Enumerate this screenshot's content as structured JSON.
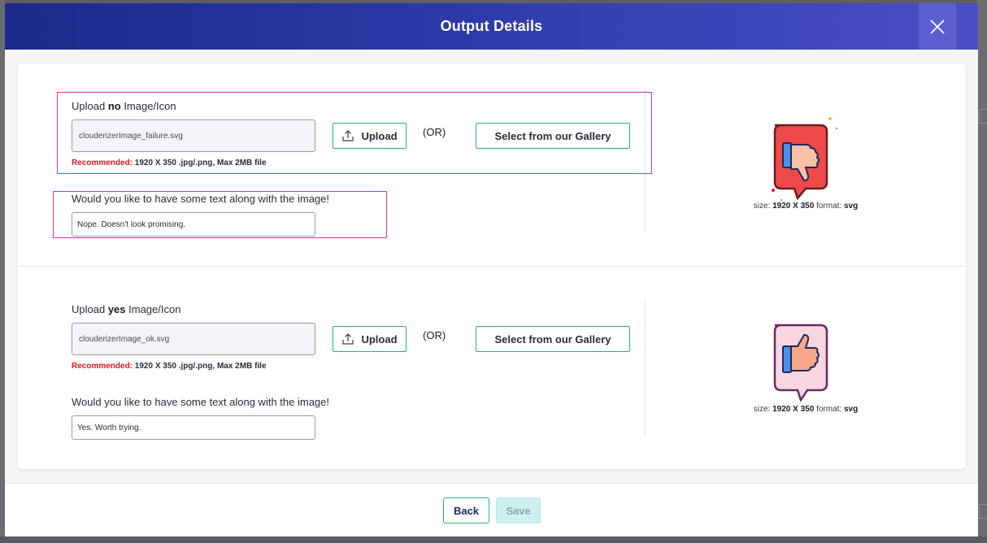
{
  "modal": {
    "title": "Output Details"
  },
  "no_section": {
    "label_prefix": "Upload ",
    "label_bold": "no",
    "label_suffix": " Image/Icon",
    "file_name": "clouderizerImage_failure.svg",
    "upload_label": "Upload",
    "or_label": "(OR)",
    "gallery_label": "Select from our Gallery",
    "recommended_label": "Recommended:",
    "recommended_text": " 1920 X 350 .jpg/.png, Max 2MB file",
    "text_question": "Would you like to have some text along with the image!",
    "text_value": "Nope. Doesn't look promising.",
    "preview": {
      "size_label": "size: ",
      "size_value": "1920 X 350",
      "format_label": " format: ",
      "format_value": "svg",
      "icon": "thumbs-down-icon"
    }
  },
  "yes_section": {
    "label_prefix": "Upload ",
    "label_bold": "yes",
    "label_suffix": " Image/Icon",
    "file_name": "clouderizerImage_ok.svg",
    "upload_label": "Upload",
    "or_label": "(OR)",
    "gallery_label": "Select from our Gallery",
    "recommended_label": "Recommended:",
    "recommended_text": " 1920 X 350 .jpg/.png, Max 2MB file",
    "text_question": "Would you like to have some text along with the image!",
    "text_value": "Yes. Worth trying.",
    "preview": {
      "size_label": "size: ",
      "size_value": "1920 X 350",
      "format_label": " format: ",
      "format_value": "svg",
      "icon": "thumbs-up-icon"
    }
  },
  "footer": {
    "back_label": "Back",
    "save_label": "Save"
  },
  "colors": {
    "header_start": "#1c2a8a",
    "header_end": "#4a4fc4",
    "accent_green": "#2eaa8a",
    "highlight_pink": "#e2358a",
    "recommended_red": "#e0161e"
  }
}
